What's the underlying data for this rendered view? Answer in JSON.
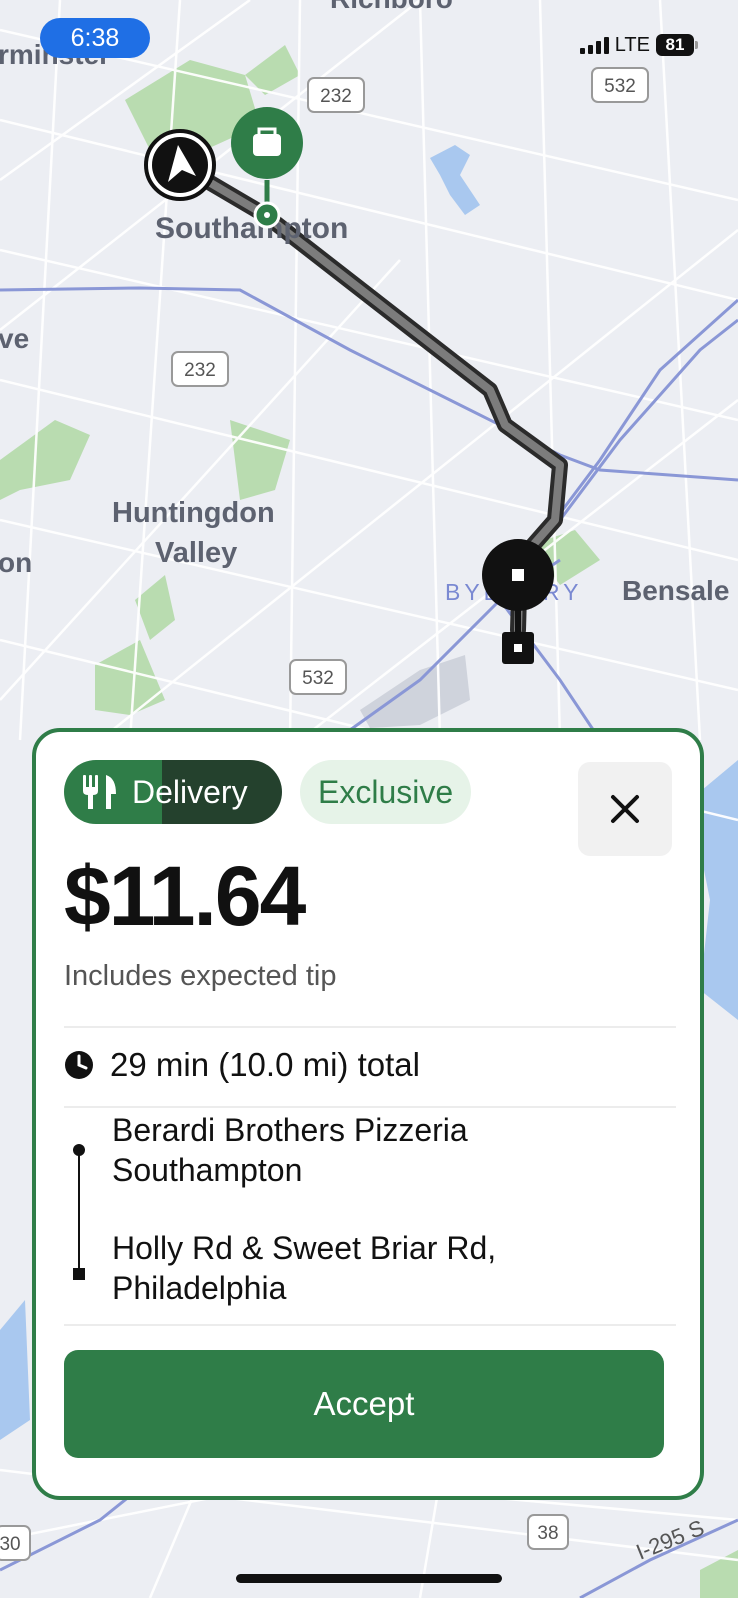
{
  "status_bar": {
    "time": "6:38",
    "network": "LTE",
    "battery": "81"
  },
  "map": {
    "labels": {
      "richboro": "Richboro",
      "warminster": "rminster",
      "southampton": "Southampton",
      "huntingdon_valley_1": "Huntingdon",
      "huntingdon_valley_2": "Valley",
      "bensalem": "Bensale",
      "byberry": "BYBERRY",
      "left_edge_1": "ve",
      "left_edge_2": "on",
      "i295": "I-295 S"
    },
    "route_shields": {
      "r232_top": "232",
      "r532_top": "532",
      "r232_mid": "232",
      "r532_bottom": "532",
      "r38": "38",
      "r30": "30"
    }
  },
  "offer_card": {
    "delivery_chip": "Delivery",
    "exclusive_chip": "Exclusive",
    "price": "$11.64",
    "tip_note": "Includes expected tip",
    "duration": "29 min (10.0 mi) total",
    "pickup": {
      "line1": "Berardi Brothers Pizzeria",
      "line2": "Southampton"
    },
    "dropoff": {
      "line1": "Holly Rd & Sweet Briar Rd,",
      "line2": "Philadelphia"
    },
    "accept_label": "Accept"
  },
  "colors": {
    "brand_green": "#2f7d48",
    "dark_green": "#24412d",
    "exclusive_bg": "#e6f3e8",
    "map_bg": "#eceef3",
    "park_green": "#b9dcb0",
    "water_blue": "#a9c8ef",
    "highway_blue": "#8a97d6",
    "time_pill": "#1f6fe5"
  },
  "icons": {
    "delivery_chip": "fork-knife-icon",
    "close": "close-icon",
    "duration": "clock-icon",
    "pickup_marker": "bag-icon",
    "driver_marker": "navigation-arrow-icon",
    "dropoff_marker": "square-stop-icon"
  }
}
